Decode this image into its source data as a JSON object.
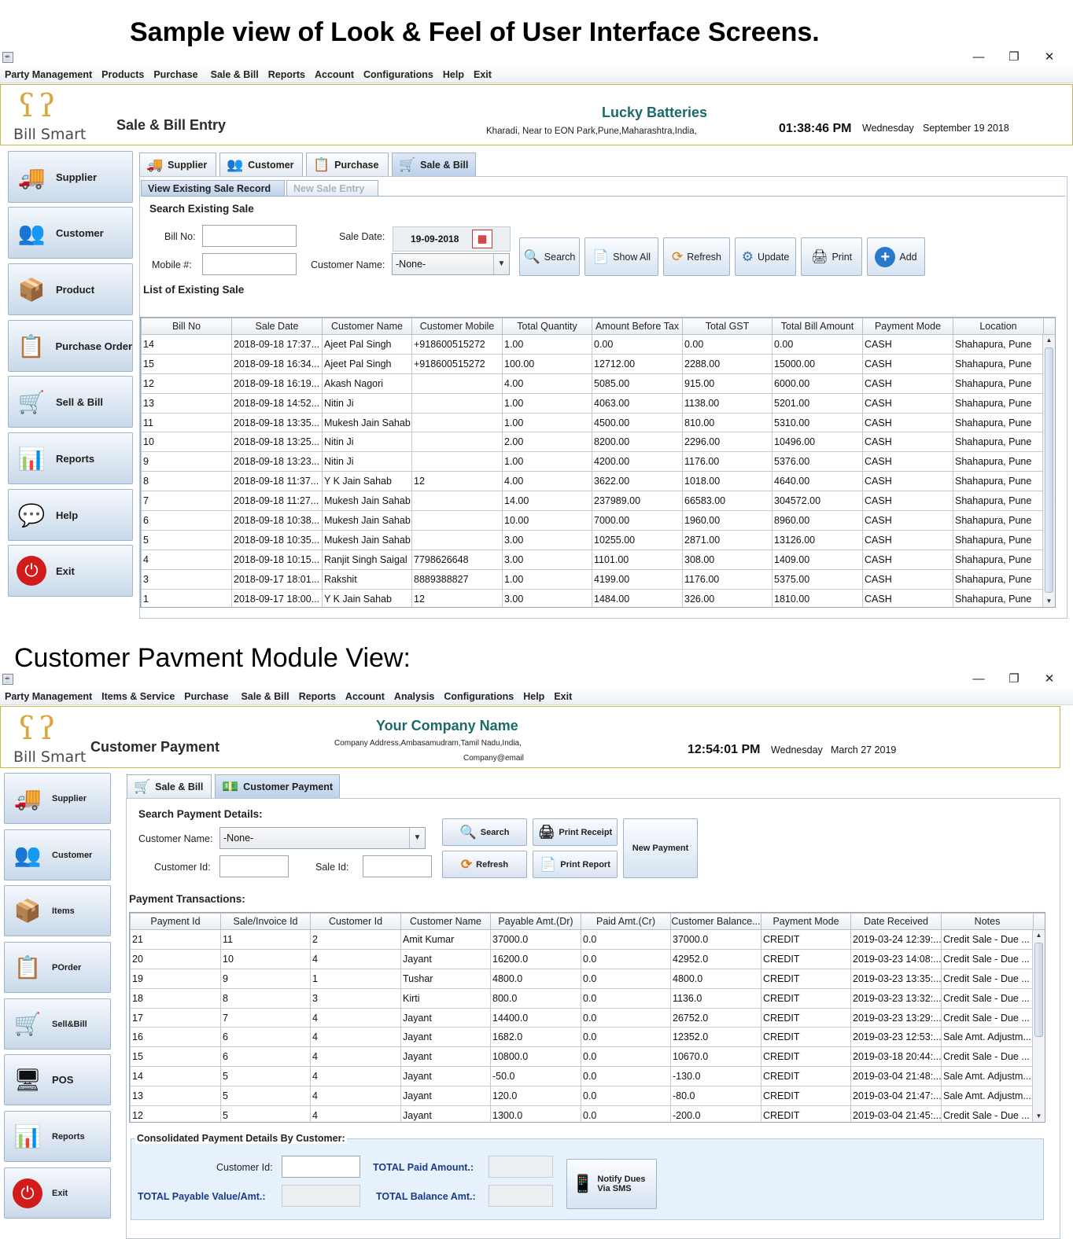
{
  "screen1": {
    "heading": "Sample view of Look & Feel of User Interface Screens.",
    "menu": [
      "Party Management",
      "Products",
      "Purchase",
      "Sale & Bill",
      "Reports",
      "Account",
      "Configurations",
      "Help",
      "Exit"
    ],
    "logo_text": "Bill Smart",
    "page_title": "Sale & Bill Entry",
    "company": "Lucky Batteries",
    "address": "Kharadi, Near to EON Park,Pune,Maharashtra,India,",
    "time": "01:38:46 PM",
    "day": "Wednesday",
    "date": "September 19 2018",
    "sidebar": [
      "Supplier",
      "Customer",
      "Product",
      "Purchase Order",
      "Sell & Bill",
      "Reports",
      "Help",
      "Exit"
    ],
    "tabs": [
      "Supplier",
      "Customer",
      "Purchase",
      "Sale & Bill"
    ],
    "subtabs": [
      "View Existing Sale Record",
      "New Sale Entry"
    ],
    "search_title": "Search Existing Sale",
    "bill_no_label": "Bill No:",
    "mobile_label": "Mobile #:",
    "sale_date_label": "Sale Date:",
    "sale_date_value": "19-09-2018",
    "customer_name_label": "Customer Name:",
    "customer_name_value": "-None-",
    "buttons": [
      "Search",
      "Show All",
      "Refresh",
      "Update",
      "Print",
      "Add"
    ],
    "list_title": "List of Existing Sale",
    "columns": [
      "Bill No",
      "Sale Date",
      "Customer Name",
      "Customer Mobile",
      "Total Quantity",
      "Amount Before Tax",
      "Total GST",
      "Total Bill Amount",
      "Payment Mode",
      "Location"
    ],
    "rows": [
      [
        "14",
        "2018-09-18 17:37...",
        "Ajeet Pal Singh",
        "+918600515272",
        "1.00",
        "0.00",
        "0.00",
        "0.00",
        "CASH",
        "Shahapura, Pune"
      ],
      [
        "15",
        "2018-09-18 16:34...",
        "Ajeet Pal Singh",
        "+918600515272",
        "100.00",
        "12712.00",
        "2288.00",
        "15000.00",
        "CASH",
        "Shahapura, Pune"
      ],
      [
        "12",
        "2018-09-18 16:19...",
        "Akash Nagori",
        "",
        "4.00",
        "5085.00",
        "915.00",
        "6000.00",
        "CASH",
        "Shahapura, Pune"
      ],
      [
        "13",
        "2018-09-18 14:52...",
        "Nitin Ji",
        "",
        "1.00",
        "4063.00",
        "1138.00",
        "5201.00",
        "CASH",
        "Shahapura, Pune"
      ],
      [
        "11",
        "2018-09-18 13:35...",
        "Mukesh Jain Sahab",
        "",
        "1.00",
        "4500.00",
        "810.00",
        "5310.00",
        "CASH",
        "Shahapura, Pune"
      ],
      [
        "10",
        "2018-09-18 13:25...",
        "Nitin Ji",
        "",
        "2.00",
        "8200.00",
        "2296.00",
        "10496.00",
        "CASH",
        "Shahapura, Pune"
      ],
      [
        "9",
        "2018-09-18 13:23...",
        "Nitin Ji",
        "",
        "1.00",
        "4200.00",
        "1176.00",
        "5376.00",
        "CASH",
        "Shahapura, Pune"
      ],
      [
        "8",
        "2018-09-18 11:37...",
        "Y K Jain Sahab",
        "12",
        "4.00",
        "3622.00",
        "1018.00",
        "4640.00",
        "CASH",
        "Shahapura, Pune"
      ],
      [
        "7",
        "2018-09-18 11:27...",
        "Mukesh Jain Sahab",
        "",
        "14.00",
        "237989.00",
        "66583.00",
        "304572.00",
        "CASH",
        "Shahapura, Pune"
      ],
      [
        "6",
        "2018-09-18 10:38...",
        "Mukesh Jain Sahab",
        "",
        "10.00",
        "7000.00",
        "1960.00",
        "8960.00",
        "CASH",
        "Shahapura, Pune"
      ],
      [
        "5",
        "2018-09-18 10:35...",
        "Mukesh Jain Sahab",
        "",
        "3.00",
        "10255.00",
        "2871.00",
        "13126.00",
        "CASH",
        "Shahapura, Pune"
      ],
      [
        "4",
        "2018-09-18 10:15...",
        "Ranjit Singh Saigal",
        "7798626648",
        "3.00",
        "1101.00",
        "308.00",
        "1409.00",
        "CASH",
        "Shahapura, Pune"
      ],
      [
        "3",
        "2018-09-17 18:01...",
        "Rakshit",
        "8889388827",
        "1.00",
        "4199.00",
        "1176.00",
        "5375.00",
        "CASH",
        "Shahapura, Pune"
      ],
      [
        "1",
        "2018-09-17 18:00...",
        "Y K Jain Sahab",
        "12",
        "3.00",
        "1484.00",
        "326.00",
        "1810.00",
        "CASH",
        "Shahapura, Pune"
      ]
    ]
  },
  "screen2": {
    "heading": "Customer Pavment Module View:",
    "menu": [
      "Party Management",
      "Items & Service",
      "Purchase",
      "Sale & Bill",
      "Reports",
      "Account",
      "Analysis",
      "Configurations",
      "Help",
      "Exit"
    ],
    "logo_text": "Bill Smart",
    "page_title": "Customer Payment",
    "company": "Your Company Name",
    "address": "Company Address,Ambasamudram,Tamil Nadu,India,",
    "email": "Company@email",
    "time": "12:54:01 PM",
    "day": "Wednesday",
    "date": "March 27 2019",
    "sidebar": [
      "Supplier",
      "Customer",
      "Items",
      "POrder",
      "Sell&Bill",
      "POS",
      "Reports",
      "Exit"
    ],
    "tabs": [
      "Sale & Bill",
      "Customer Payment"
    ],
    "search_title": "Search Payment Details:",
    "customer_name_label": "Customer Name:",
    "customer_name_value": "-None-",
    "customer_id_label": "Customer Id:",
    "sale_id_label": "Sale Id:",
    "buttons": {
      "search": "Search",
      "print_receipt": "Print Receipt",
      "refresh": "Refresh",
      "print_report": "Print Report",
      "new_payment": "New Payment"
    },
    "transactions_title": "Payment Transactions:",
    "columns": [
      "Payment Id",
      "Sale/Invoice Id",
      "Customer Id",
      "Customer Name",
      "Payable Amt.(Dr)",
      "Paid Amt.(Cr)",
      "Customer Balance...",
      "Payment Mode",
      "Date Received",
      "Notes"
    ],
    "rows": [
      [
        "21",
        "11",
        "2",
        "Amit Kumar",
        "37000.0",
        "0.0",
        "37000.0",
        "CREDIT",
        "2019-03-24 12:39:...",
        "Credit Sale - Due ..."
      ],
      [
        "20",
        "10",
        "4",
        "Jayant",
        "16200.0",
        "0.0",
        "42952.0",
        "CREDIT",
        "2019-03-23 14:08:...",
        "Credit Sale - Due ..."
      ],
      [
        "19",
        "9",
        "1",
        "Tushar",
        "4800.0",
        "0.0",
        "4800.0",
        "CREDIT",
        "2019-03-23 13:35:...",
        "Credit Sale - Due ..."
      ],
      [
        "18",
        "8",
        "3",
        "Kirti",
        "800.0",
        "0.0",
        "1136.0",
        "CREDIT",
        "2019-03-23 13:32:...",
        "Credit Sale - Due ..."
      ],
      [
        "17",
        "7",
        "4",
        "Jayant",
        "14400.0",
        "0.0",
        "26752.0",
        "CREDIT",
        "2019-03-23 13:29:...",
        "Credit Sale - Due ..."
      ],
      [
        "16",
        "6",
        "4",
        "Jayant",
        "1682.0",
        "0.0",
        "12352.0",
        "CREDIT",
        "2019-03-23 12:53:...",
        "Sale Amt. Adjustm..."
      ],
      [
        "15",
        "6",
        "4",
        "Jayant",
        "10800.0",
        "0.0",
        "10670.0",
        "CREDIT",
        "2019-03-18 20:44:...",
        "Credit Sale - Due ..."
      ],
      [
        "14",
        "5",
        "4",
        "Jayant",
        "-50.0",
        "0.0",
        "-130.0",
        "CREDIT",
        "2019-03-04 21:48:...",
        "Sale Amt. Adjustm..."
      ],
      [
        "13",
        "5",
        "4",
        "Jayant",
        "120.0",
        "0.0",
        "-80.0",
        "CREDIT",
        "2019-03-04 21:47:...",
        "Sale Amt. Adjustm..."
      ],
      [
        "12",
        "5",
        "4",
        "Jayant",
        "1300.0",
        "0.0",
        "-200.0",
        "CREDIT",
        "2019-03-04 21:45:...",
        "Credit Sale - Due ..."
      ]
    ],
    "consolidated_title": "Consolidated Payment Details By Customer:",
    "cons_customer_id_label": "Customer Id:",
    "total_paid_label": "TOTAL Paid Amount.:",
    "total_payable_label": "TOTAL Payable Value/Amt.:",
    "total_balance_label": "TOTAL Balance Amt.:",
    "notify_button": "Notify Dues Via SMS"
  },
  "window_controls": {
    "minimize": "—",
    "restore": "❐",
    "close": "✕"
  }
}
